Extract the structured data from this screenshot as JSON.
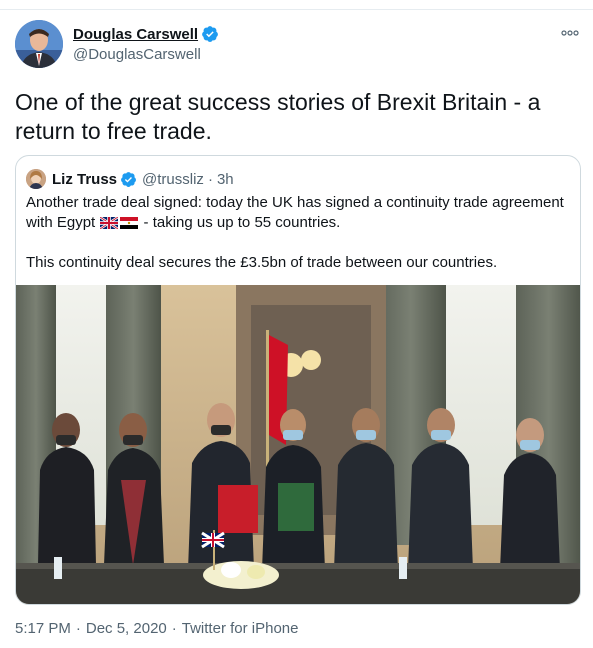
{
  "tweet": {
    "author_name": "Douglas Carswell",
    "author_handle": "@DouglasCarswell",
    "text": "One of the great success stories of Brexit Britain - a return to free trade.",
    "timestamp": "5:17 PM · Dec 5, 2020",
    "time": "5:17 PM",
    "date": "Dec 5, 2020",
    "client": "Twitter for iPhone",
    "more_icon": "more-horizontal-icon"
  },
  "quote": {
    "author_name": "Liz Truss",
    "author_handle": "@trussliz",
    "separator": "·",
    "time_ago": "3h",
    "text_line1": "Another trade deal signed: today the UK has signed a continuity trade agreement with Egypt",
    "text_line1_tail": "- taking us up to 55 countries.",
    "text_para2": "This continuity deal secures the £3.5bn of trade between our countries.",
    "flags": [
      "uk-flag-icon",
      "egypt-flag-icon"
    ],
    "image_alt": "Photo of seven officials in suits and face masks standing behind a table with UK and Egypt flags, holding signed red and green folders"
  },
  "colors": {
    "text_primary": "#0f1419",
    "text_secondary": "#536471",
    "verified": "#1d9bf0",
    "border": "#cfd9de"
  }
}
